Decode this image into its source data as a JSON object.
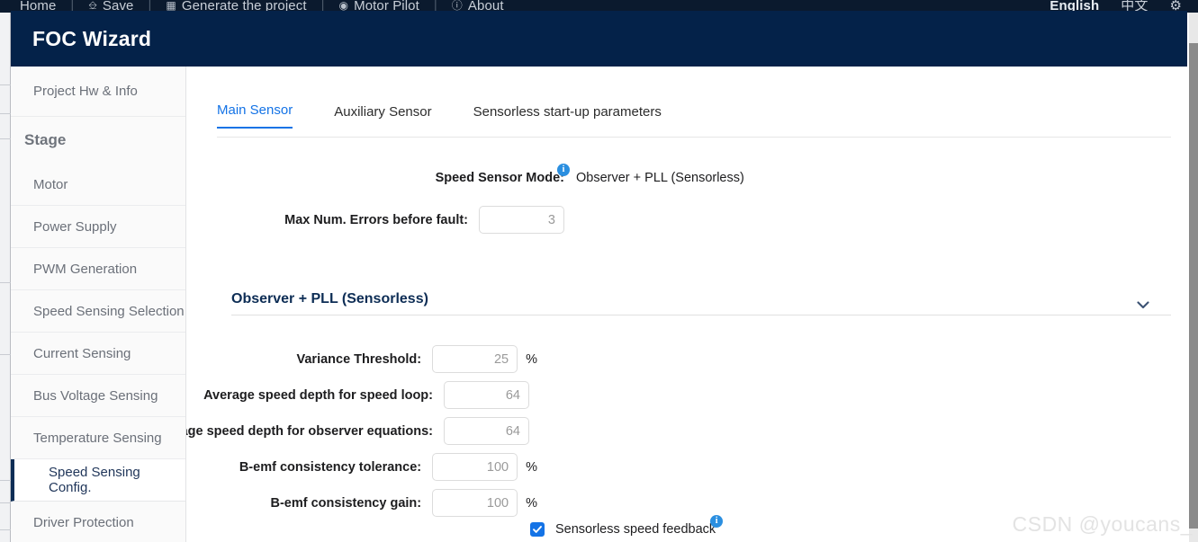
{
  "app_menu": {
    "items": [
      {
        "label": "Home",
        "icon": ""
      },
      {
        "label": "Save",
        "icon": "save-icon"
      },
      {
        "label": "Generate the project",
        "icon": "generate-icon"
      },
      {
        "label": "Motor Pilot",
        "icon": "motor-pilot-icon"
      },
      {
        "label": "About",
        "icon": "about-icon"
      }
    ],
    "separator": "|",
    "right_items": [
      {
        "label": "English",
        "active": true
      },
      {
        "label": "中文",
        "active": false
      }
    ],
    "settings_icon": "gear-icon"
  },
  "window": {
    "title": "FOC Wizard",
    "header_color": "#042249"
  },
  "sidebar": {
    "top_item": {
      "label": "Project Hw & Info"
    },
    "heading": "Stage",
    "items": [
      {
        "label": "Motor",
        "active": false
      },
      {
        "label": "Power Supply",
        "active": false
      },
      {
        "label": "PWM Generation",
        "active": false
      },
      {
        "label": "Speed Sensing Selection",
        "active": false
      },
      {
        "label": "Current Sensing",
        "active": false
      },
      {
        "label": "Bus Voltage Sensing",
        "active": false
      },
      {
        "label": "Temperature Sensing",
        "active": false
      },
      {
        "label": "Speed Sensing Config.",
        "active": true
      },
      {
        "label": "Driver Protection",
        "active": false
      }
    ],
    "active_accent": "#0d2d55"
  },
  "tabs": {
    "accent": "#1473e6",
    "items": [
      {
        "label": "Main Sensor",
        "active": true
      },
      {
        "label": "Auxiliary Sensor",
        "active": false
      },
      {
        "label": "Sensorless start-up parameters",
        "active": false
      }
    ]
  },
  "main": {
    "speed_sensor_mode": {
      "label": "Speed Sensor Mode:",
      "value": "Observer + PLL (Sensorless)",
      "info_badge": "i"
    },
    "max_errors": {
      "label": "Max Num. Errors before fault:",
      "value": "3"
    },
    "section": {
      "title": "Observer + PLL (Sensorless)",
      "collapse_icon": "chevron-down-icon"
    },
    "fields": [
      {
        "label": "Variance Threshold:",
        "value": "25",
        "unit": "%"
      },
      {
        "label": "Average speed depth for speed loop:",
        "value": "64",
        "unit": ""
      },
      {
        "label": "Average speed depth for observer equations:",
        "value": "64",
        "unit": ""
      },
      {
        "label": "B-emf consistency tolerance:",
        "value": "100",
        "unit": "%"
      },
      {
        "label": "B-emf consistency gain:",
        "value": "100",
        "unit": "%"
      }
    ],
    "checkbox": {
      "label": "Sensorless speed feedback",
      "checked": true,
      "info_badge": "i"
    }
  },
  "watermark": {
    "text": "CSDN @youcans_"
  }
}
